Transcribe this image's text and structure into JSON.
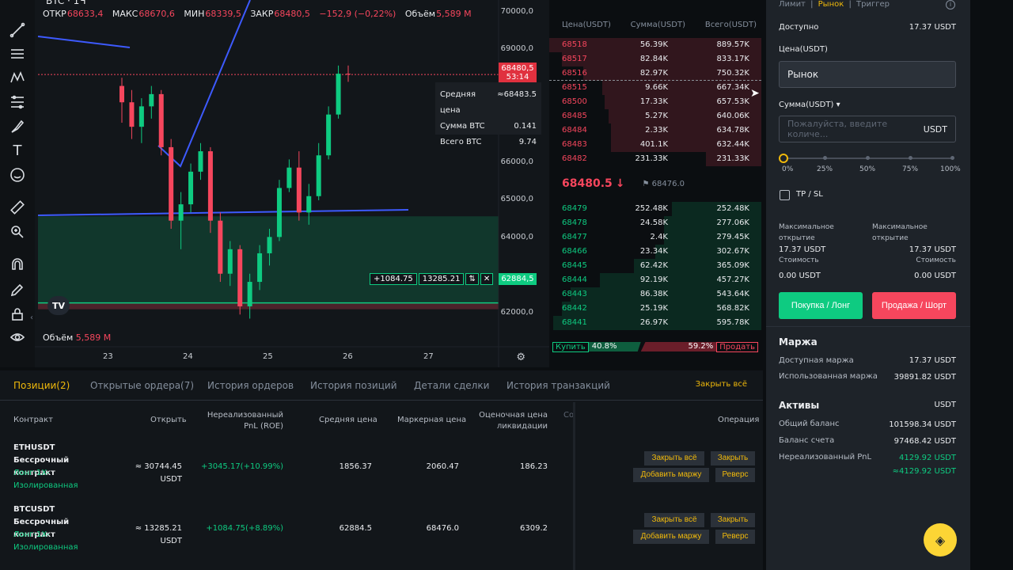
{
  "chart": {
    "symbol": "BTC · 1Ч",
    "ohlc": {
      "open_label": "ОТКР",
      "open": "68633,4",
      "high_label": "МАКС",
      "high": "68670,6",
      "low_label": "МИН",
      "low": "68339,5",
      "close_label": "ЗАКР",
      "close": "68480,5",
      "change": "−152,9 (−0,22%)",
      "volume_label": "Объём",
      "volume": "5,589 M"
    },
    "y_ticks": [
      "70000,0",
      "69000,0",
      "66000,0",
      "65000,0",
      "64000,0",
      "62000,0"
    ],
    "x_ticks": [
      "23",
      "24",
      "25",
      "26",
      "27"
    ],
    "last_price_tag": "68480,5",
    "last_price_timer": "53:14",
    "position_price_tag": "62884,5",
    "avg_box": [
      {
        "label": "Средняя цена",
        "value": "≈68483.5"
      },
      {
        "label": "Сумма BTC",
        "value": "0.141"
      },
      {
        "label": "Всего BTC",
        "value": "9.74"
      }
    ],
    "position_label": {
      "pnl": "+1084.75",
      "amount": "13285.21",
      "reverse": "⇅",
      "close": "✕"
    },
    "volume_label": "Объём",
    "volume_value": "5,589 M",
    "logo": "TV",
    "colors": {
      "up": "#0ecb81",
      "down": "#f6465d",
      "drawing": "#3d5afe"
    }
  },
  "chart_data": {
    "type": "candlestick",
    "y_range": [
      61500,
      70500
    ],
    "x_labels": [
      "23",
      "24",
      "25",
      "26",
      "27"
    ],
    "candles": [
      [
        68200,
        68400,
        67300,
        67800
      ],
      [
        67800,
        68100,
        66900,
        67200
      ],
      [
        67200,
        67900,
        66800,
        67700
      ],
      [
        67700,
        68200,
        67400,
        68000
      ],
      [
        68000,
        68100,
        66500,
        66700
      ],
      [
        66700,
        66900,
        64700,
        64900
      ],
      [
        64900,
        65600,
        64200,
        65300
      ],
      [
        65300,
        66300,
        65100,
        66100
      ],
      [
        66100,
        66800,
        65900,
        66600
      ],
      [
        66600,
        66700,
        64600,
        64900
      ],
      [
        64900,
        65100,
        63400,
        63600
      ],
      [
        63600,
        64400,
        63300,
        64200
      ],
      [
        64200,
        64300,
        62600,
        62800
      ],
      [
        62800,
        63600,
        62500,
        63400
      ],
      [
        63400,
        64300,
        63200,
        64100
      ],
      [
        64100,
        64700,
        63800,
        64500
      ],
      [
        64500,
        65900,
        64400,
        65700
      ],
      [
        65700,
        66400,
        65600,
        66200
      ],
      [
        66200,
        66600,
        64900,
        65100
      ],
      [
        65100,
        65800,
        64800,
        65500
      ],
      [
        65500,
        66800,
        65400,
        66500
      ],
      [
        66500,
        67700,
        66400,
        67500
      ],
      [
        67500,
        68700,
        67400,
        68500
      ],
      [
        68500,
        68700,
        68300,
        68480
      ]
    ],
    "annotations": {
      "horizontal_line": 65200,
      "position_entry": 62884.5,
      "last_price": 68480.5
    }
  },
  "orderbook": {
    "headers": [
      "Цена(USDT)",
      "Сумма(USDT)",
      "Всего(USDT)"
    ],
    "asks": [
      {
        "price": "68518",
        "amount": "56.39K",
        "total": "889.57K",
        "depth": 1.0
      },
      {
        "price": "68517",
        "amount": "82.84K",
        "total": "833.17K",
        "depth": 0.94
      },
      {
        "price": "68516",
        "amount": "82.97K",
        "total": "750.32K",
        "depth": 0.84
      },
      {
        "price": "68515",
        "amount": "9.66K",
        "total": "667.34K",
        "depth": 0.75
      },
      {
        "price": "68500",
        "amount": "17.33K",
        "total": "657.53K",
        "depth": 0.74
      },
      {
        "price": "68485",
        "amount": "5.27K",
        "total": "640.06K",
        "depth": 0.72
      },
      {
        "price": "68484",
        "amount": "2.33K",
        "total": "634.78K",
        "depth": 0.71
      },
      {
        "price": "68483",
        "amount": "401.1K",
        "total": "632.44K",
        "depth": 0.71
      },
      {
        "price": "68482",
        "amount": "231.33K",
        "total": "231.33K",
        "depth": 0.26
      }
    ],
    "last_price": "68480.5",
    "last_arrow": "↓",
    "mark_price": "68476.0",
    "flag_icon": "flag-icon",
    "bids": [
      {
        "price": "68479",
        "amount": "252.48K",
        "total": "252.48K",
        "depth": 0.42
      },
      {
        "price": "68478",
        "amount": "24.58K",
        "total": "277.06K",
        "depth": 0.46
      },
      {
        "price": "68477",
        "amount": "2.4K",
        "total": "279.45K",
        "depth": 0.46
      },
      {
        "price": "68466",
        "amount": "23.34K",
        "total": "302.67K",
        "depth": 0.5
      },
      {
        "price": "68445",
        "amount": "62.42K",
        "total": "365.09K",
        "depth": 0.6
      },
      {
        "price": "68444",
        "amount": "92.19K",
        "total": "457.27K",
        "depth": 0.76
      },
      {
        "price": "68443",
        "amount": "86.38K",
        "total": "543.64K",
        "depth": 0.9
      },
      {
        "price": "68442",
        "amount": "25.19K",
        "total": "568.82K",
        "depth": 0.94
      },
      {
        "price": "68441",
        "amount": "26.97K",
        "total": "595.78K",
        "depth": 0.98
      }
    ],
    "buy_label": "Купить",
    "buy_pct": "40.8%",
    "sell_pct": "59.2%",
    "sell_label": "Продать",
    "buy_ratio": 0.408
  },
  "order_panel": {
    "order_types": [
      "Лимит",
      "Рынок",
      "Триггер"
    ],
    "sep": "|",
    "available_label": "Доступно",
    "available_value": "17.37 USDT",
    "price_label": "Цена(USDT)",
    "price_value": "Рынок",
    "amount_label": "Сумма(USDT) ▾",
    "amount_placeholder": "Пожалуйста, введите количе...",
    "amount_unit": "USDT",
    "slider_marks": [
      "0%",
      "25%",
      "50%",
      "75%",
      "100%"
    ],
    "slider_value": 0,
    "tpsl_label": "TP / SL",
    "max_open_label": "Максимальное открытие",
    "max_open_long": "17.37 USDT",
    "max_open_short": "17.37 USDT",
    "cost_label": "Стоимость",
    "cost_long": "0.00 USDT",
    "cost_short": "0.00 USDT",
    "buy_button": "Покупка / Лонг",
    "sell_button": "Продажа / Шорт",
    "margin_title": "Маржа",
    "available_margin_label": "Доступная маржа",
    "available_margin_value": "17.37 USDT",
    "used_margin_label": "Использованная маржа",
    "used_margin_value": "39891.82 USDT",
    "assets_title": "Активы",
    "assets_unit": "USDT",
    "total_balance_label": "Общий баланс",
    "total_balance_value": "101598.34 USDT",
    "account_balance_label": "Баланс счета",
    "account_balance_value": "97468.42 USDT",
    "upnl_label": "Нереализованный PnL",
    "upnl_value_1": "4129.92 USDT",
    "upnl_value_2": "≈4129.92 USDT"
  },
  "positions": {
    "tabs": [
      "Позиции(2)",
      "Открытые ордера(7)",
      "История ордеров",
      "История позиций",
      "Детали сделки",
      "История транзакций"
    ],
    "close_all": "Закрыть всё",
    "headers": {
      "contract": "Контракт",
      "open": "Открыть",
      "upnl": "Нереализованный PnL (ROE)",
      "avg": "Средняя цена",
      "mark": "Маркерная цена",
      "liq": "Оценочная цена ликвидации",
      "cut": "Со",
      "operation": "Операция"
    },
    "rows": [
      {
        "name": "ETHUSDT Бессрочный контракт",
        "mode": "Лонг-1X-Изолированная",
        "open": "≈ 30744.45 USDT",
        "upnl": "+3045.17(+10.99%)",
        "avg": "1856.37",
        "mark": "2060.47",
        "liq": "186.23",
        "close_all": "Закрыть всё",
        "close": "Закрыть",
        "add_margin": "Добавить маржу",
        "reverse": "Реверс"
      },
      {
        "name": "BTCUSDT Бессрочный контракт",
        "mode": "Лонг-1X-Изолированная",
        "open": "≈ 13285.21 USDT",
        "upnl": "+1084.75(+8.89%)",
        "avg": "62884.5",
        "mark": "68476.0",
        "liq": "6309.2",
        "close_all": "Закрыть всё",
        "close": "Закрыть",
        "add_margin": "Добавить маржу",
        "reverse": "Реверс"
      }
    ]
  },
  "fab_icon": "swap-icon"
}
